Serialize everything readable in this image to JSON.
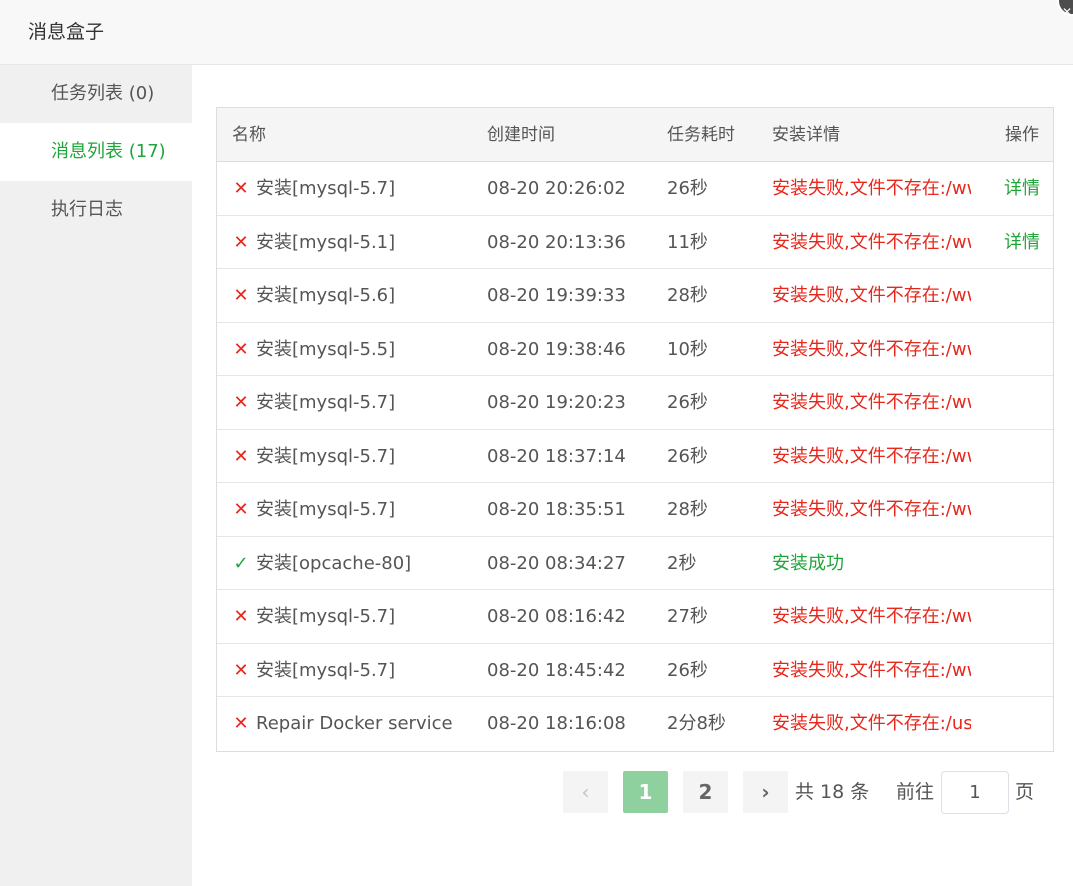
{
  "dialog": {
    "title": "消息盒子",
    "close_icon": "close-icon"
  },
  "sidebar": {
    "items": [
      {
        "label": "任务列表 (0)",
        "active": false
      },
      {
        "label": "消息列表 (17)",
        "active": true
      },
      {
        "label": "执行日志",
        "active": false
      }
    ]
  },
  "table": {
    "headers": {
      "name": "名称",
      "time": "创建时间",
      "duration": "任务耗时",
      "detail": "安装详情",
      "op": "操作"
    },
    "rows": [
      {
        "status": "fail",
        "name": "安装[mysql-5.7]",
        "time": "08-20 20:26:02",
        "duration": "26秒",
        "detail": "安装失败,文件不存在:/ww",
        "op": "详情"
      },
      {
        "status": "fail",
        "name": "安装[mysql-5.1]",
        "time": "08-20 20:13:36",
        "duration": "11秒",
        "detail": "安装失败,文件不存在:/ww",
        "op": "详情"
      },
      {
        "status": "fail",
        "name": "安装[mysql-5.6]",
        "time": "08-20 19:39:33",
        "duration": "28秒",
        "detail": "安装失败,文件不存在:/ww",
        "op": ""
      },
      {
        "status": "fail",
        "name": "安装[mysql-5.5]",
        "time": "08-20 19:38:46",
        "duration": "10秒",
        "detail": "安装失败,文件不存在:/ww",
        "op": ""
      },
      {
        "status": "fail",
        "name": "安装[mysql-5.7]",
        "time": "08-20 19:20:23",
        "duration": "26秒",
        "detail": "安装失败,文件不存在:/ww",
        "op": ""
      },
      {
        "status": "fail",
        "name": "安装[mysql-5.7]",
        "time": "08-20 18:37:14",
        "duration": "26秒",
        "detail": "安装失败,文件不存在:/ww",
        "op": ""
      },
      {
        "status": "fail",
        "name": "安装[mysql-5.7]",
        "time": "08-20 18:35:51",
        "duration": "28秒",
        "detail": "安装失败,文件不存在:/ww",
        "op": ""
      },
      {
        "status": "ok",
        "name": "安装[opcache-80]",
        "time": "08-20 08:34:27",
        "duration": "2秒",
        "detail": "安装成功",
        "op": ""
      },
      {
        "status": "fail",
        "name": "安装[mysql-5.7]",
        "time": "08-20 08:16:42",
        "duration": "27秒",
        "detail": "安装失败,文件不存在:/ww",
        "op": ""
      },
      {
        "status": "fail",
        "name": "安装[mysql-5.7]",
        "time": "08-20 18:45:42",
        "duration": "26秒",
        "detail": "安装失败,文件不存在:/ww",
        "op": ""
      },
      {
        "status": "fail",
        "name": "Repair Docker service",
        "time": "08-20 18:16:08",
        "duration": "2分8秒",
        "detail": "安装失败,文件不存在:/us",
        "op": ""
      }
    ]
  },
  "pagination": {
    "prev_icon": "chevron-left-icon",
    "next_icon": "chevron-right-icon",
    "pages": [
      "1",
      "2"
    ],
    "current_page": "1",
    "total_text": "共 18 条",
    "goto_label": "前往",
    "goto_value": "1",
    "goto_unit": "页"
  },
  "colors": {
    "accent": "#20a53a",
    "error": "#e8271c",
    "current_page_bg": "#8fd19e"
  }
}
